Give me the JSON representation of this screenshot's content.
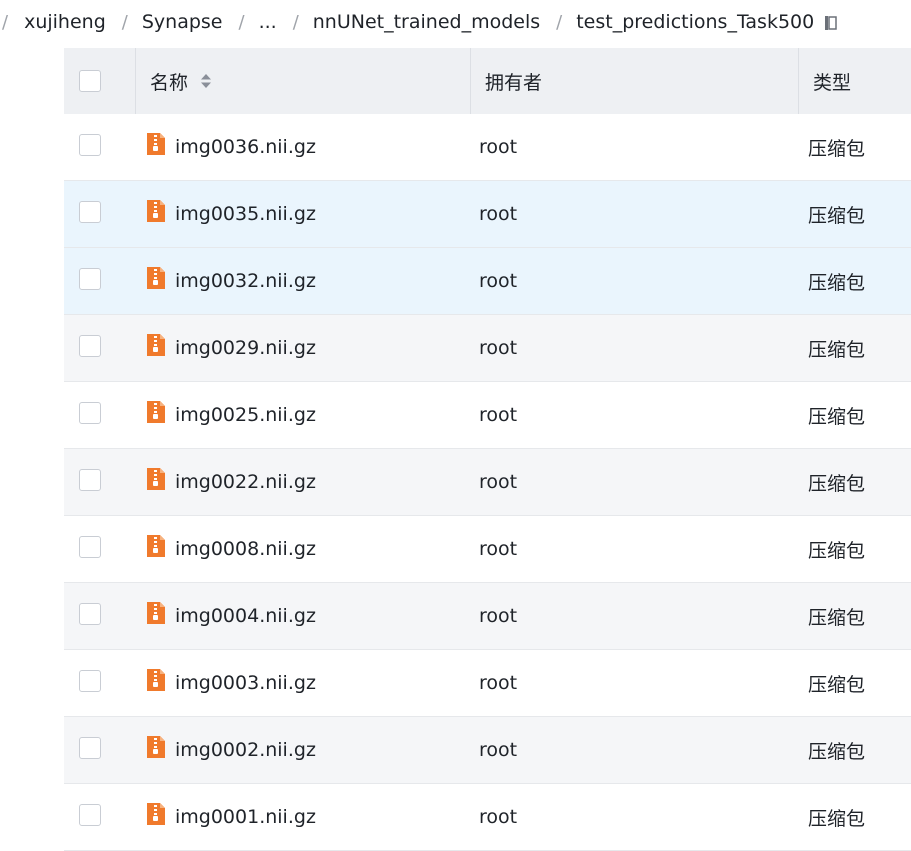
{
  "breadcrumb": {
    "items": [
      "xujiheng",
      "Synapse",
      "...",
      "nnUNet_trained_models",
      "test_predictions_Task500"
    ]
  },
  "table": {
    "columns": {
      "name": "名称",
      "owner": "拥有者",
      "type": "类型"
    },
    "rows": [
      {
        "name": "img0036.nii.gz",
        "owner": "root",
        "type": "压缩包"
      },
      {
        "name": "img0035.nii.gz",
        "owner": "root",
        "type": "压缩包"
      },
      {
        "name": "img0032.nii.gz",
        "owner": "root",
        "type": "压缩包"
      },
      {
        "name": "img0029.nii.gz",
        "owner": "root",
        "type": "压缩包"
      },
      {
        "name": "img0025.nii.gz",
        "owner": "root",
        "type": "压缩包"
      },
      {
        "name": "img0022.nii.gz",
        "owner": "root",
        "type": "压缩包"
      },
      {
        "name": "img0008.nii.gz",
        "owner": "root",
        "type": "压缩包"
      },
      {
        "name": "img0004.nii.gz",
        "owner": "root",
        "type": "压缩包"
      },
      {
        "name": "img0003.nii.gz",
        "owner": "root",
        "type": "压缩包"
      },
      {
        "name": "img0002.nii.gz",
        "owner": "root",
        "type": "压缩包"
      },
      {
        "name": "img0001.nii.gz",
        "owner": "root",
        "type": "压缩包"
      }
    ]
  },
  "colors": {
    "file_icon": "#f07a2c",
    "header_bg": "#eef0f3",
    "highlight_bg": "#eaf5fd"
  },
  "icons": {
    "copy": "copy-icon",
    "sort": "sort-icon",
    "file": "zip-file-icon"
  }
}
